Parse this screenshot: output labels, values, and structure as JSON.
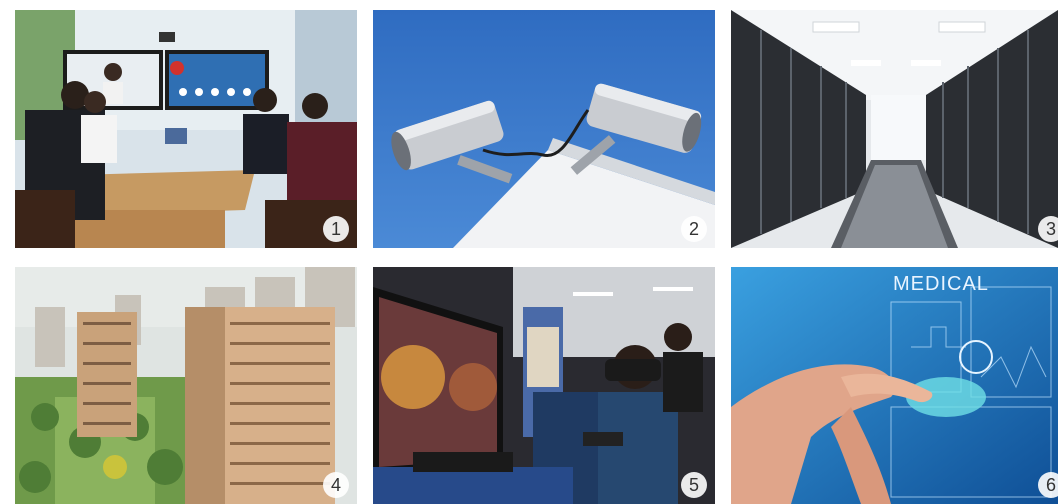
{
  "tiles": [
    {
      "badge": "1",
      "scene": "video-conference-meeting"
    },
    {
      "badge": "2",
      "scene": "security-cameras"
    },
    {
      "badge": "3",
      "scene": "server-room"
    },
    {
      "badge": "4",
      "scene": "residential-buildings"
    },
    {
      "badge": "5",
      "scene": "virtual-reality-gaming"
    },
    {
      "badge": "6",
      "scene": "medical-touch-interface"
    }
  ],
  "medical": {
    "title": "MEDICAL"
  },
  "colors": {
    "sky": "#3a78c9",
    "server_floor": "#e9ecef",
    "medical_blue": "#2a8fd6"
  }
}
